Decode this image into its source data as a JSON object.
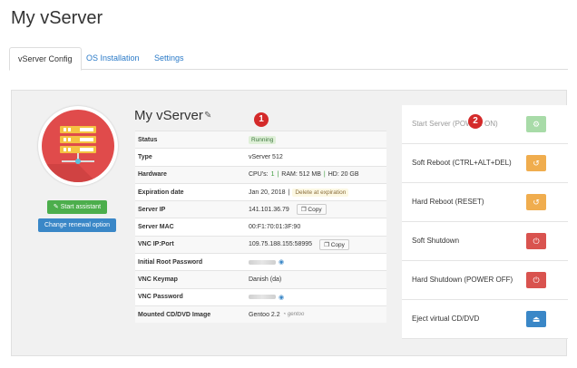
{
  "page": {
    "title": "My vServer"
  },
  "tabs": [
    {
      "label": "vServer Config",
      "active": true
    },
    {
      "label": "OS Installation",
      "active": false
    },
    {
      "label": "Settings",
      "active": false
    }
  ],
  "left": {
    "start_assistant": "✎ Start assistant",
    "change_renewal": "Change renewal option"
  },
  "server": {
    "name": "My vServer",
    "edit_icon": "pencil-icon",
    "marker1": "1",
    "rows": {
      "status": {
        "key": "Status",
        "value": "Running"
      },
      "type": {
        "key": "Type",
        "value": "vServer 512"
      },
      "hardware": {
        "key": "Hardware",
        "cpu_label": "CPU's:",
        "cpu": "1",
        "sep1": "|",
        "ram": "RAM: 512 MB",
        "sep2": "|",
        "hd": "HD: 20 GB"
      },
      "expiration": {
        "key": "Expiration date",
        "value": "Jan 20, 2018",
        "sep": "|",
        "action": "Delete at expiration"
      },
      "ip": {
        "key": "Server IP",
        "value": "141.101.36.79",
        "copy": "Copy"
      },
      "mac": {
        "key": "Server MAC",
        "value": "00:F1:70:01:3F:90"
      },
      "vnc_ip": {
        "key": "VNC IP:Port",
        "value": "109.75.188.155:58995",
        "copy": "Copy"
      },
      "root_pw": {
        "key": "Initial Root Password"
      },
      "keymap": {
        "key": "VNC Keymap",
        "value": "Danish (da)"
      },
      "vnc_pw": {
        "key": "VNC Password"
      },
      "cd": {
        "key": "Mounted CD/DVD Image",
        "value": "Gentoo 2.2",
        "logo": "gentoo"
      }
    }
  },
  "actions": {
    "marker2": "2",
    "items": [
      {
        "label": "Start Server (POWER ON)",
        "color": "#a8dba8",
        "icon": "⚙"
      },
      {
        "label": "Soft Reboot (CTRL+ALT+DEL)",
        "color": "#f0ad4e",
        "icon": "↺"
      },
      {
        "label": "Hard Reboot (RESET)",
        "color": "#f0ad4e",
        "icon": "↺"
      },
      {
        "label": "Soft Shutdown",
        "color": "#d9534f",
        "icon": "⏻"
      },
      {
        "label": "Hard Shutdown (POWER OFF)",
        "color": "#d9534f",
        "icon": "⏻"
      },
      {
        "label": "Eject virtual CD/DVD",
        "color": "#3a87c7",
        "icon": "⏏"
      }
    ]
  }
}
